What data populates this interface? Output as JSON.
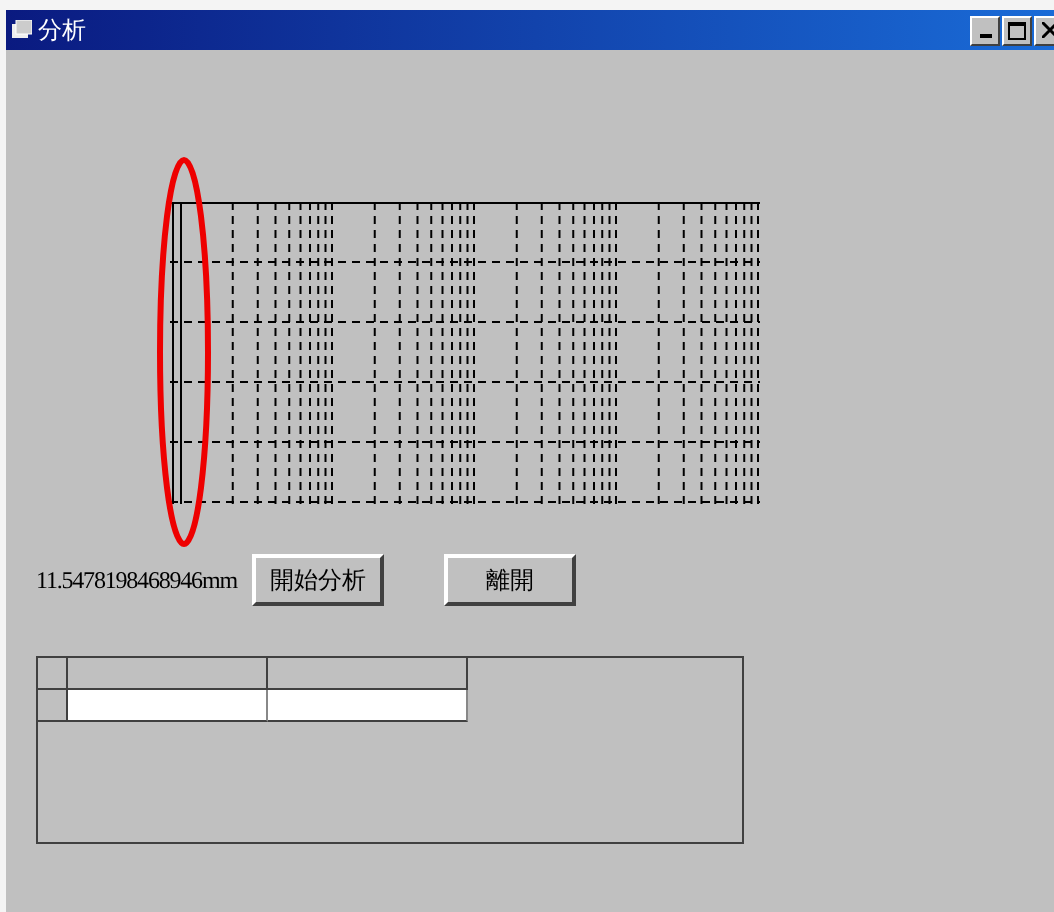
{
  "window": {
    "title": "分析",
    "controls": [
      {
        "kind": "minimize"
      },
      {
        "kind": "maximize"
      },
      {
        "kind": "close"
      }
    ]
  },
  "readout": "11.5478198468946mm",
  "buttons": [
    {
      "label": "開始分析"
    },
    {
      "label": "離開"
    }
  ]
}
